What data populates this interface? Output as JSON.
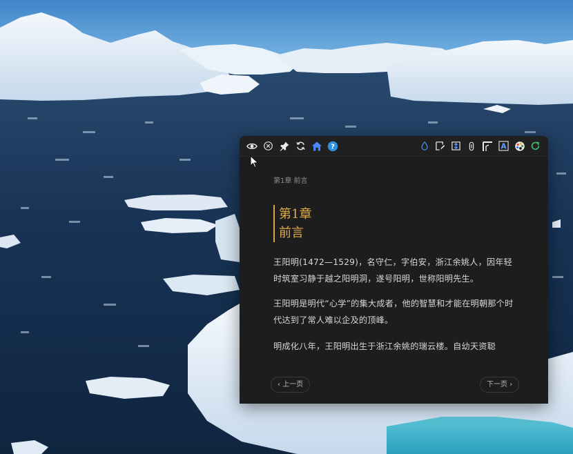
{
  "toolbar": {
    "left_icons": [
      "eye-icon",
      "close-circle-icon",
      "pin-icon",
      "sync-icon",
      "home-icon",
      "help-icon"
    ],
    "right_icons": [
      "water-drop-icon",
      "edit-note-icon",
      "export-icon",
      "attachment-icon",
      "corner-icon",
      "font-icon",
      "color-palette-icon",
      "refresh-icon"
    ],
    "help_label": "?",
    "font_label": "A"
  },
  "colors": {
    "accent_gold": "#e3ad47",
    "home_blue": "#4d84ff",
    "help_blue": "#2f8fe0",
    "reader_bg": "#1d1d1d"
  },
  "reader": {
    "breadcrumb": "第1章 前言",
    "title_line1": "第1章",
    "title_line2": "前言",
    "paragraphs": [
      "王阳明(1472—1529)，名守仁，字伯安，浙江余姚人，因年轻时筑室习静于越之阳明洞，遂号阳明，世称阳明先生。",
      "王阳明是明代“心学”的集大成者，他的智慧和才能在明朝那个时代达到了常人难以企及的顶峰。",
      "明成化八年，王阳明出生于浙江余姚的瑞云楼。自幼天资聪"
    ],
    "prev_label": "上一页",
    "next_label": "下一页"
  }
}
